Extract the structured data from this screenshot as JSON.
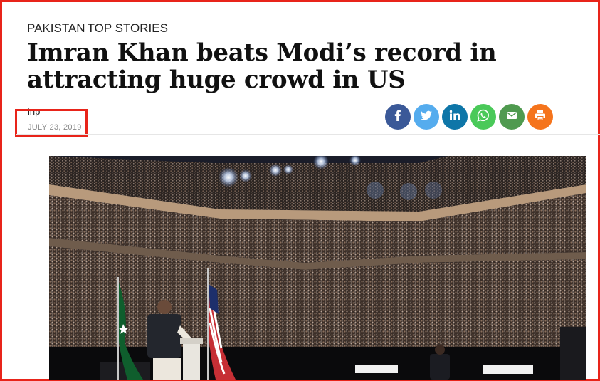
{
  "article": {
    "categories": [
      "PAKISTAN",
      "TOP STORIES"
    ],
    "headline": "Imran Khan beats Modi’s record in attracting huge crowd in US",
    "author": "inp",
    "date": "JULY 23, 2019"
  },
  "share": [
    {
      "icon": "facebook-icon",
      "color": "#3b5998"
    },
    {
      "icon": "twitter-icon",
      "color": "#55acee"
    },
    {
      "icon": "linkedin-icon",
      "color": "#0e76a8"
    },
    {
      "icon": "whatsapp-icon",
      "color": "#4ac959"
    },
    {
      "icon": "email-icon",
      "color": "#4f9a4f"
    },
    {
      "icon": "print-icon",
      "color": "#f5741c"
    }
  ],
  "colors": {
    "highlight": "#e8241a"
  }
}
